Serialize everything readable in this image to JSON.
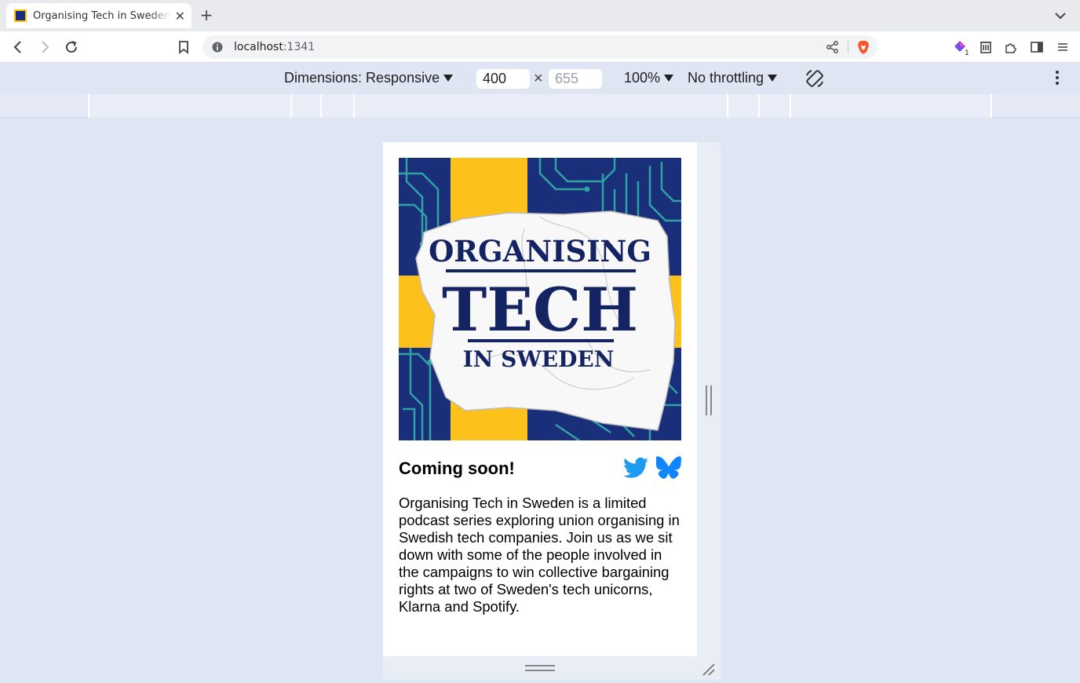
{
  "browser": {
    "tab": {
      "title": "Organising Tech in Sweden"
    },
    "address": {
      "host": "localhost",
      "port": ":1341"
    },
    "icons": [
      "back-icon",
      "forward-icon",
      "reload-icon",
      "bookmark-icon",
      "site-info-icon",
      "share-icon",
      "brave-shields-icon",
      "extension-leo-icon",
      "wallet-icon",
      "extensions-icon",
      "sidebar-icon",
      "menu-icon"
    ]
  },
  "devtools": {
    "dimensions_label": "Dimensions: Responsive",
    "width_value": "400",
    "height_placeholder": "655",
    "times": "×",
    "zoom_label": "100%",
    "throttling_label": "No throttling"
  },
  "page": {
    "cover": {
      "line1": "ORGANISING",
      "line2": "TECH",
      "line3": "IN SWEDEN",
      "colors": {
        "navy": "#1a2f7a",
        "yellow": "#fdc11c",
        "circuit": "#2fa3a3"
      }
    },
    "heading": "Coming soon!",
    "social": [
      "twitter-icon",
      "bluesky-icon"
    ],
    "description": "Organising Tech in Sweden is a limited podcast series exploring union organising in Swedish tech companies. Join us as we sit down with some of the people involved in the campaigns to win collective bargaining rights at two of Sweden's tech unicorns, Klarna and Spotify."
  }
}
